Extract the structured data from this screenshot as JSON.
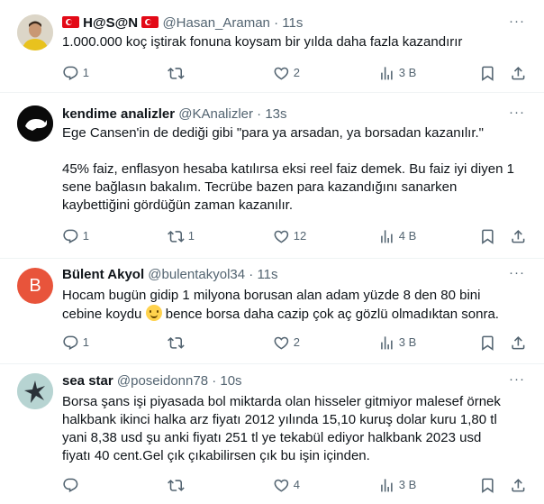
{
  "tweets": [
    {
      "display_name": "H@S@N",
      "handle": "@Hasan_Araman",
      "time": "11s",
      "lines": [
        "1.000.000 koç iştirak fonuna koysam bir yılda daha fazla kazandırır"
      ],
      "replies": "1",
      "retweets": "",
      "likes": "2",
      "views": "3 B"
    },
    {
      "display_name": "kendime analizler",
      "handle": "@KAnalizler",
      "time": "13s",
      "lines": [
        "Ege Cansen'in de dediği gibi \"para ya arsadan, ya borsadan kazanılır.\"",
        "",
        "45% faiz, enflasyon hesaba katılırsa eksi reel faiz demek. Bu faiz iyi diyen  1",
        "sene bağlasın bakalım. Tecrübe bazen para kazandığını sanarken",
        "kaybettiğini gördüğün zaman kazanılır."
      ],
      "replies": "1",
      "retweets": "1",
      "likes": "12",
      "views": "4 B"
    },
    {
      "display_name": "Bülent Akyol",
      "handle": "@bulentakyol34",
      "time": "11s",
      "avatar_letter": "B",
      "lines_a": "Hocam bugün gidip 1 milyona borusan alan adam yüzde 8 den 80 bini",
      "line_b_before": "cebine koydu ",
      "line_b_after": " bence borsa daha cazip çok aç gözlü olmadıktan sonra.",
      "replies": "1",
      "retweets": "",
      "likes": "2",
      "views": "3 B"
    },
    {
      "display_name": "sea star",
      "handle": "@poseidonn78",
      "time": "10s",
      "lines": [
        "Borsa  şans işi piyasada bol miktarda olan hisseler gitmiyor malesef örnek",
        "halkbank ikinci halka arz fiyatı 2012 yılında 15,10 kuruş dolar kuru 1,80 tl",
        "yani 8,38 usd şu anki fiyatı 251 tl ye tekabül ediyor halkbank 2023 usd",
        "fiyatı 40 cent.Gel çık çıkabilirsen çık bu işin içinden."
      ],
      "replies": "",
      "retweets": "",
      "likes": "4",
      "views": "3 B"
    }
  ],
  "icons": [
    "reply-icon",
    "retweet-icon",
    "like-icon",
    "views-icon",
    "bookmark-icon",
    "share-icon",
    "more-icon",
    "turkey-flag-icon",
    "smile-emoji-icon"
  ],
  "colors": {
    "text": "#0f1419",
    "muted": "#536471",
    "divider": "#eff3f4",
    "avatar_b": "#e8543b"
  }
}
